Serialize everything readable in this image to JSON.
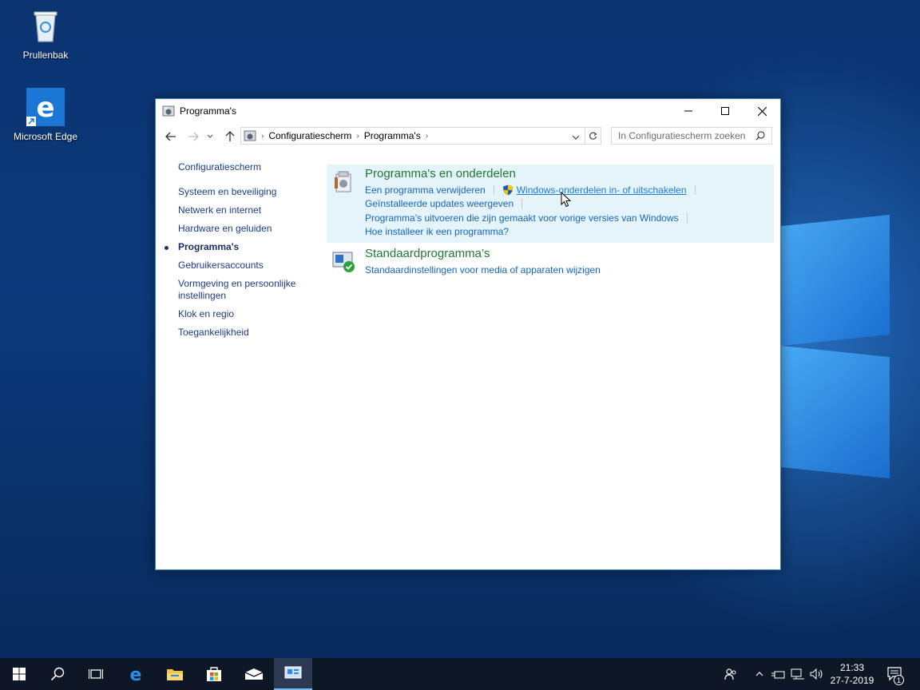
{
  "desktop": {
    "icons": [
      {
        "label": "Prullenbak"
      },
      {
        "label": "Microsoft Edge"
      }
    ]
  },
  "window": {
    "title": "Programma's",
    "breadcrumb": [
      "Configuratiescherm",
      "Programma's"
    ],
    "search_placeholder": "In Configuratiescherm zoeken",
    "left_nav": {
      "home": "Configuratiescherm",
      "items": [
        {
          "label": "Systeem en beveiliging",
          "active": false
        },
        {
          "label": "Netwerk en internet",
          "active": false
        },
        {
          "label": "Hardware en geluiden",
          "active": false
        },
        {
          "label": "Programma's",
          "active": true
        },
        {
          "label": "Gebruikersaccounts",
          "active": false
        },
        {
          "label": "Vormgeving en persoonlijke instellingen",
          "active": false
        },
        {
          "label": "Klok en regio",
          "active": false
        },
        {
          "label": "Toegankelijkheid",
          "active": false
        }
      ]
    },
    "categories": [
      {
        "title": "Programma's en onderdelen",
        "links": [
          "Een programma verwijderen",
          "Windows-onderdelen in- of uitschakelen",
          "Geïnstalleerde updates weergeven",
          "Programma’s uitvoeren die zijn gemaakt voor vorige versies van Windows",
          "Hoe installeer ik een programma?"
        ]
      },
      {
        "title": "Standaardprogramma’s",
        "links": [
          "Standaardinstellingen voor media of apparaten wijzigen"
        ]
      }
    ]
  },
  "taskbar": {
    "clock_time": "21:33",
    "clock_date": "27-7-2019",
    "notification_count": "1"
  },
  "colors": {
    "accent": "#1565c0",
    "category_title": "#1e7a2e",
    "highlight": "#e5f3fb",
    "taskbar": "#0e1726"
  }
}
